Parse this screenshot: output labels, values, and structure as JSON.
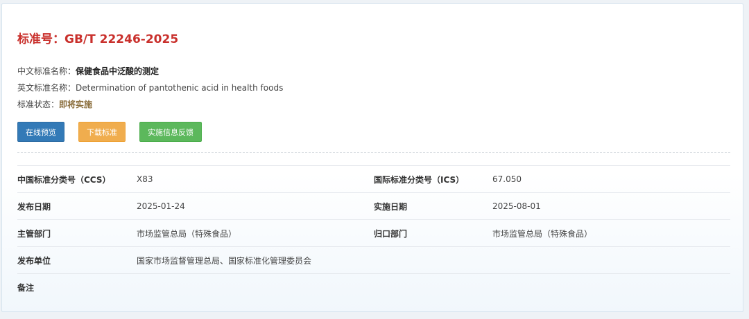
{
  "header": {
    "title": "标准号：GB/T 22246-2025"
  },
  "info": {
    "cn_name_label": "中文标准名称：",
    "cn_name_value": "保健食品中泛酸的测定",
    "en_name_label": "英文标准名称：",
    "en_name_value": "Determination of pantothenic acid in health foods",
    "status_label": "标准状态：",
    "status_value": "即将实施"
  },
  "actions": {
    "preview": "在线预览",
    "download": "下载标准",
    "feedback": "实施信息反馈"
  },
  "details": {
    "ccs_label": "中国标准分类号（CCS）",
    "ccs_value": "X83",
    "ics_label": "国际标准分类号（ICS）",
    "ics_value": "67.050",
    "publish_date_label": "发布日期",
    "publish_date_value": "2025-01-24",
    "implement_date_label": "实施日期",
    "implement_date_value": "2025-08-01",
    "dept_label": "主管部门",
    "dept_value": "市场监管总局（特殊食品）",
    "centralized_label": "归口部门",
    "centralized_value": "市场监管总局（特殊食品）",
    "publisher_label": "发布单位",
    "publisher_value": "国家市场监督管理总局、国家标准化管理委员会",
    "remark_label": "备注",
    "remark_value": ""
  },
  "colors": {
    "title": "#c9302c",
    "status": "#8a6d3b",
    "preview_button": "#337ab7",
    "download_button": "#f0ad4e",
    "feedback_button": "#5cb85c"
  }
}
